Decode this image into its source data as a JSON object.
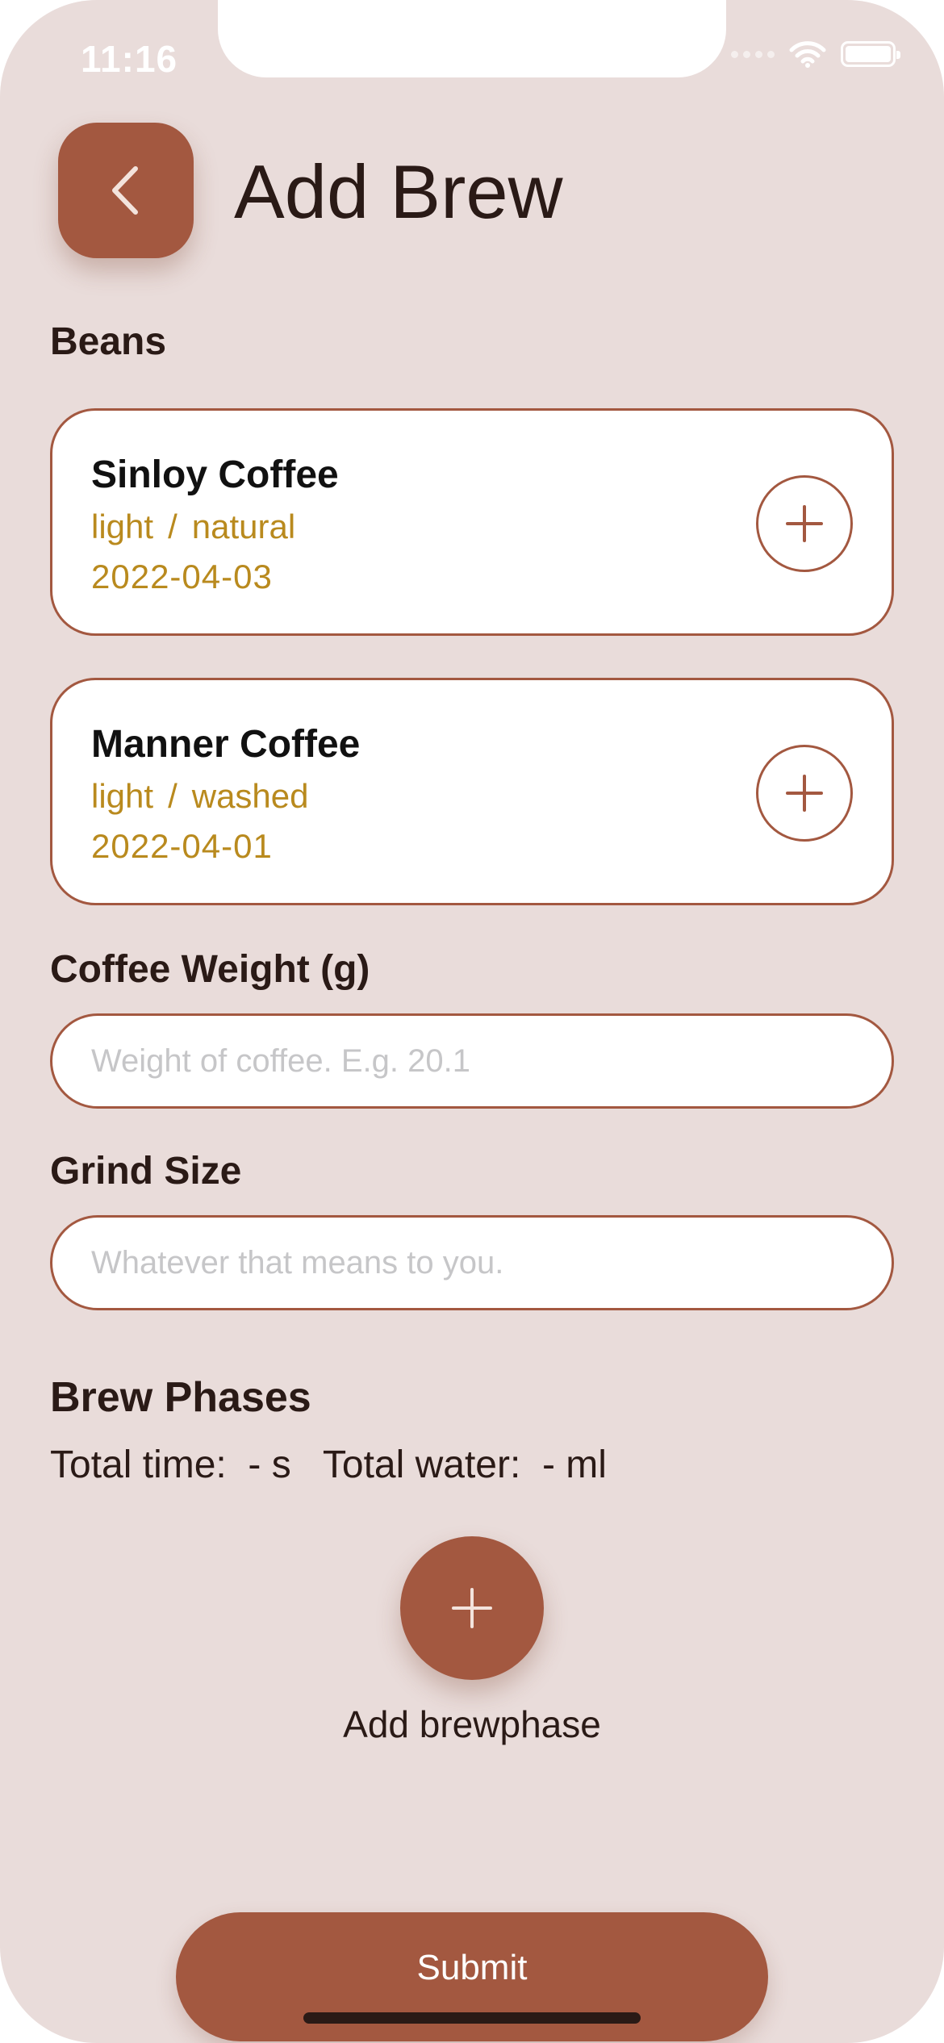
{
  "status_bar": {
    "time": "11:16"
  },
  "header": {
    "title": "Add Brew"
  },
  "beans": {
    "label": "Beans",
    "items": [
      {
        "name": "Sinloy Coffee",
        "roast": "light",
        "separator": "/",
        "process": "natural",
        "date": "2022-04-03"
      },
      {
        "name": "Manner Coffee",
        "roast": "light",
        "separator": "/",
        "process": "washed",
        "date": "2022-04-01"
      }
    ]
  },
  "coffee_weight": {
    "label": "Coffee Weight (g)",
    "placeholder": "Weight of coffee. E.g. 20.1",
    "value": ""
  },
  "grind_size": {
    "label": "Grind Size",
    "placeholder": "Whatever that means to you.",
    "value": ""
  },
  "brew_phases": {
    "label": "Brew Phases",
    "totals_text": "Total time:  - s   Total water:  - ml",
    "add_label": "Add brewphase"
  },
  "submit": {
    "label": "Submit"
  },
  "colors": {
    "background": "#e9dcda",
    "accent": "#a35840",
    "meta_text": "#b98a1e",
    "title_text": "#2a1a16",
    "card": "#ffffff"
  },
  "icons": {
    "back": "chevron-left-icon",
    "add": "plus-icon",
    "wifi": "wifi-icon",
    "battery": "battery-icon",
    "signal": "signal-icon"
  }
}
